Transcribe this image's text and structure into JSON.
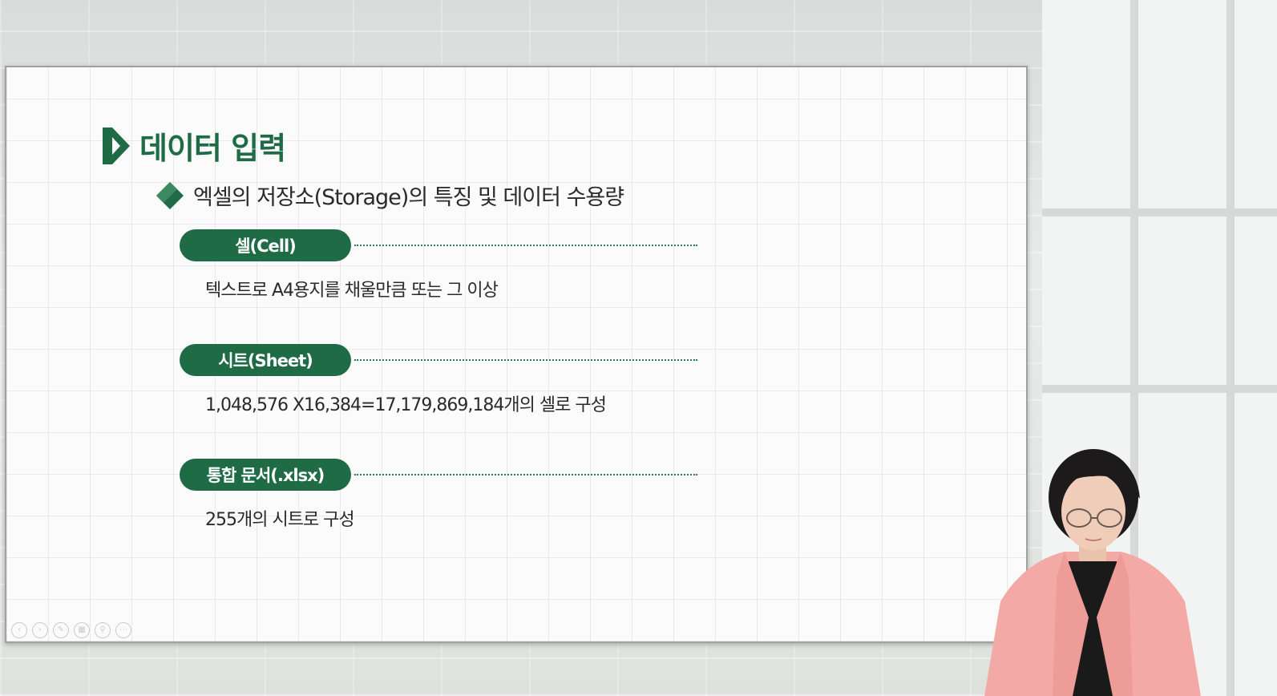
{
  "slide": {
    "title": "데이터 입력",
    "subtitle": "엑셀의 저장소(Storage)의 특징 및 데이터 수용량",
    "sections": [
      {
        "label": "셀(Cell)",
        "description": "텍스트로 A4용지를 채울만큼 또는 그 이상"
      },
      {
        "label": "시트(Sheet)",
        "description": "1,048,576 X16,384=17,179,869,184개의 셀로 구성"
      },
      {
        "label": "통합 문서(.xlsx)",
        "description": "255개의 시트로 구성"
      }
    ]
  },
  "toolbar": {
    "icons": [
      "prev-icon",
      "next-icon",
      "pen-icon",
      "slides-icon",
      "zoom-icon",
      "menu-icon"
    ],
    "glyphs": [
      "‹",
      "›",
      "✎",
      "▦",
      "⚲",
      "⋯"
    ]
  },
  "colors": {
    "accent": "#1e6b46",
    "text": "#2a2a2a",
    "slide_bg": "#fbfbfb"
  }
}
